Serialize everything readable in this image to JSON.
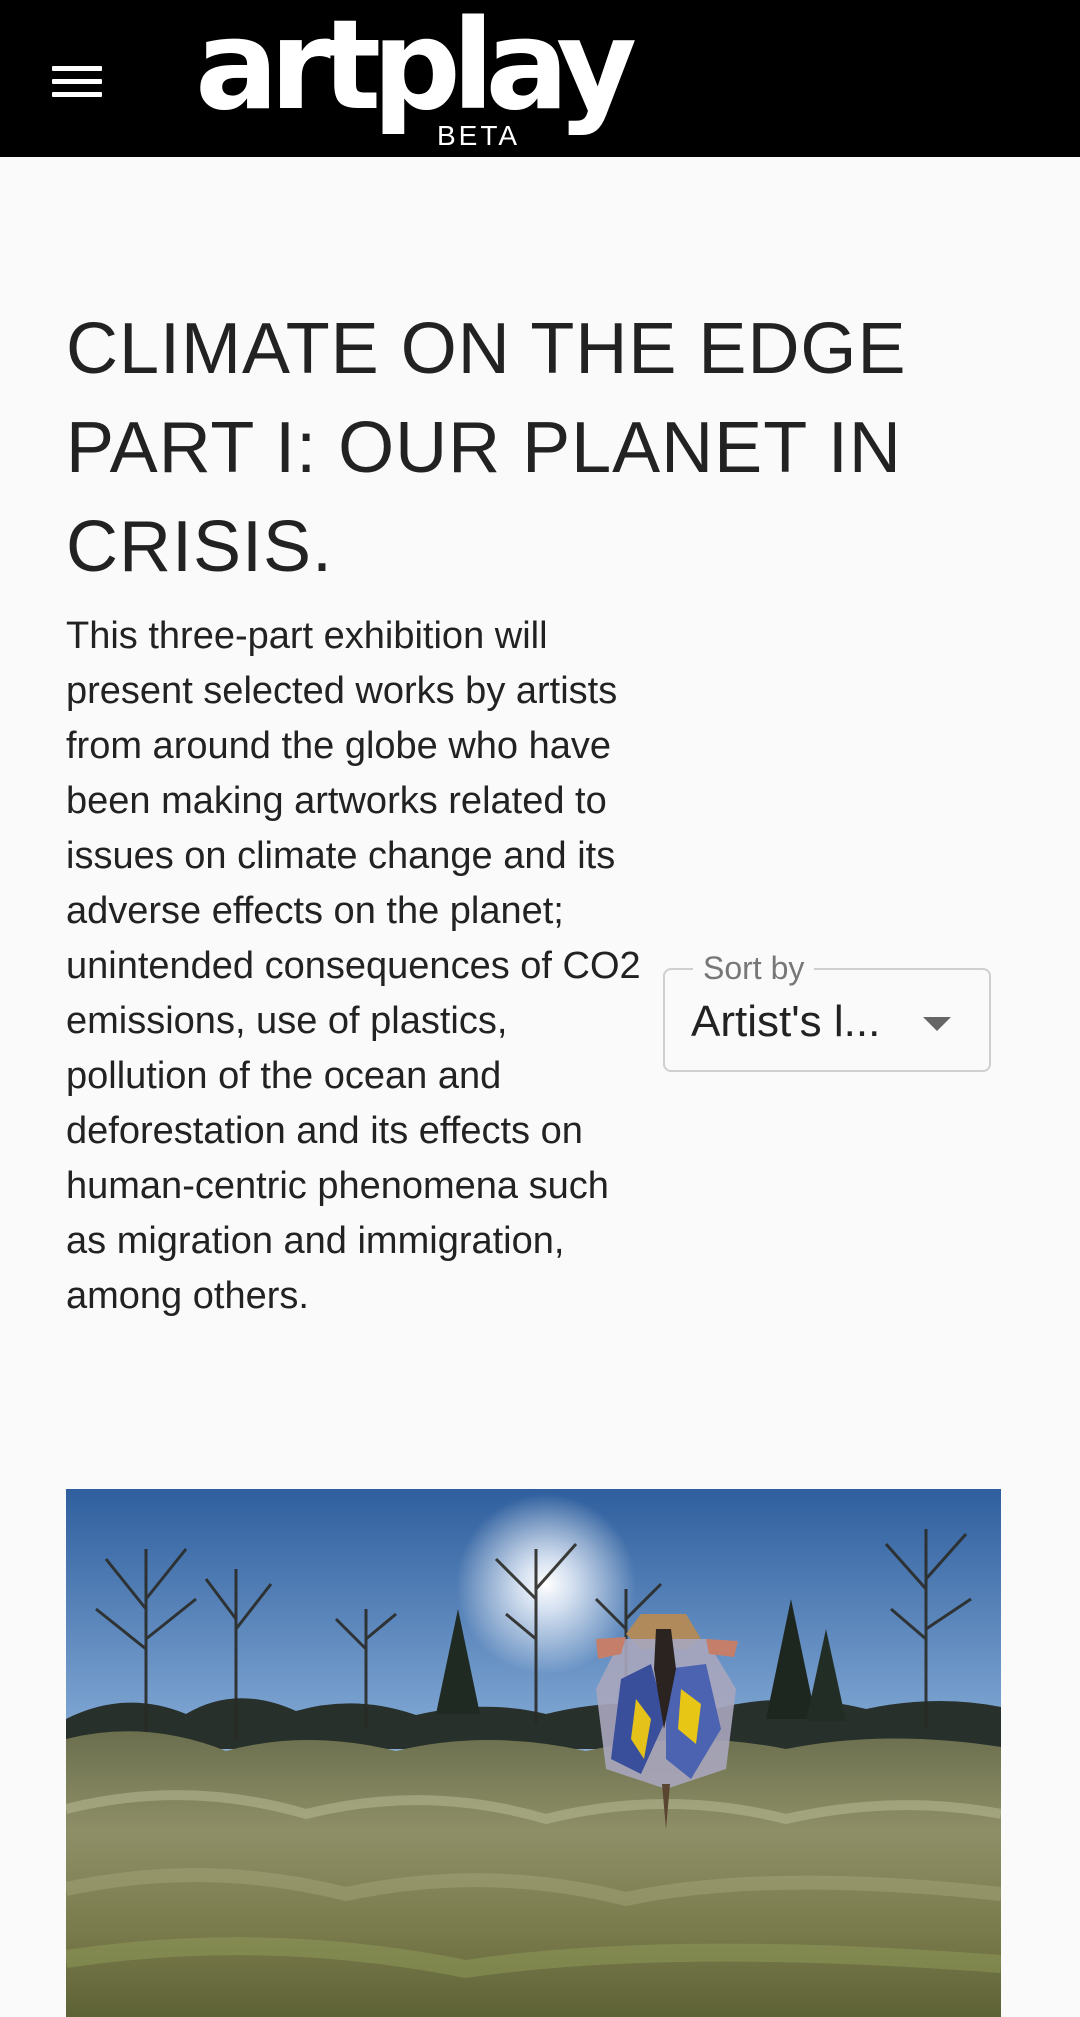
{
  "header": {
    "menu_icon": "hamburger-menu-icon",
    "logo_text": "artplay",
    "logo_badge": "BETA",
    "background": "#000000"
  },
  "exhibition": {
    "title": "CLIMATE ON THE EDGE PART I: OUR PLANET IN CRISIS.",
    "description": "This three-part exhibition will present selected works by artists from around the globe who have been making artworks related to issues on climate change and its adverse effects on the planet; unintended consequences of CO2 emissions, use of plastics, pollution of the ocean and deforestation and its effects on human-centric phenomena such as migration and immigration, among others."
  },
  "sort": {
    "label": "Sort by",
    "selected": "Artist's l...",
    "icon": "caret-down-icon"
  },
  "artwork": {
    "image": "landscape with bare trees, frosted grassy mounds and a colorful costumed figure"
  }
}
